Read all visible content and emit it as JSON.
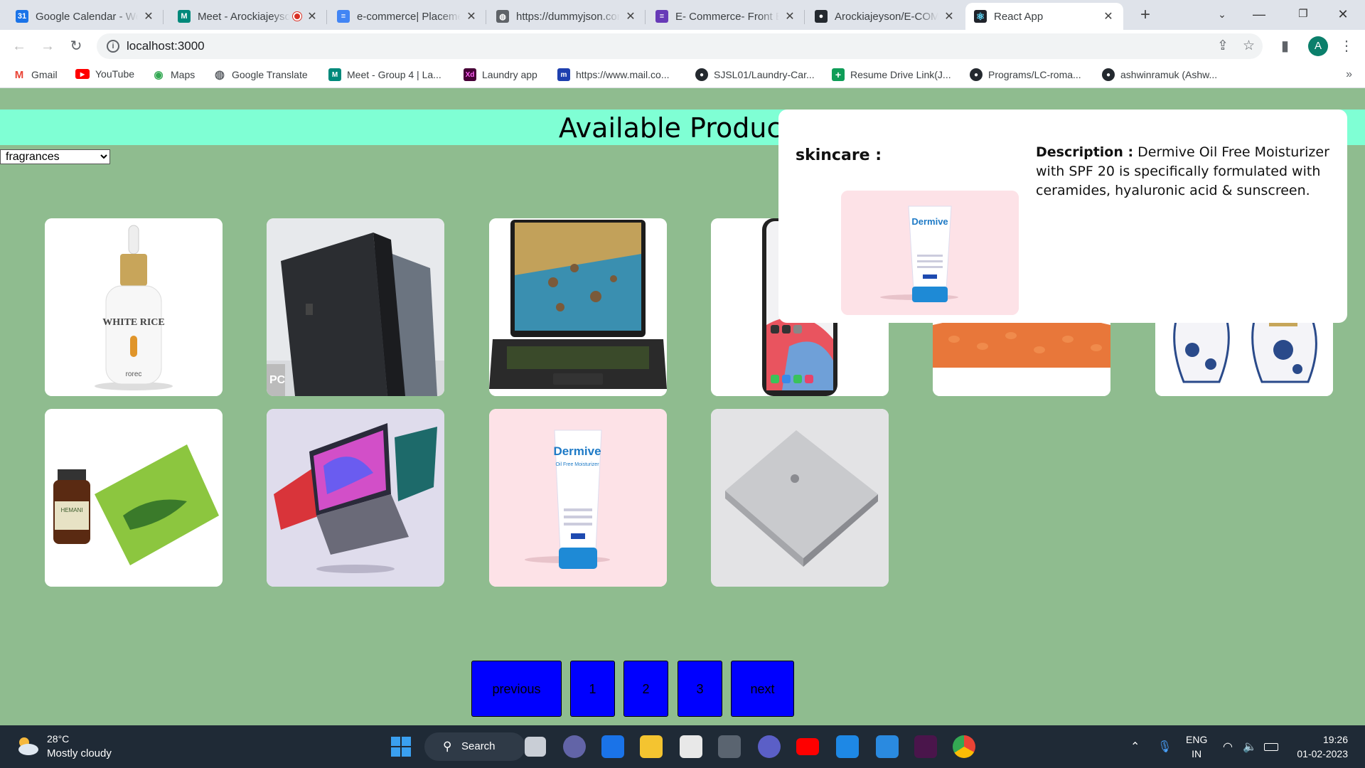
{
  "browser": {
    "tabs": [
      {
        "title": "Google Calendar - Week",
        "favicon": "calendar-icon",
        "color": "#1a73e8",
        "glyph": "31"
      },
      {
        "title": "Meet - Arockiajeyson",
        "favicon": "meet-icon",
        "color": "#00897b",
        "glyph": "M"
      },
      {
        "title": "e-commerce| Placement",
        "favicon": "docs-icon",
        "color": "#4285f4",
        "glyph": "≡"
      },
      {
        "title": "https://dummyjson.com",
        "favicon": "globe-icon",
        "color": "#5f6368",
        "glyph": "◍"
      },
      {
        "title": "E- Commerce- Front End",
        "favicon": "forms-icon",
        "color": "#673ab7",
        "glyph": "≡"
      },
      {
        "title": "Arockiajeyson/E-COMMERCE",
        "favicon": "github-icon",
        "color": "#24292f",
        "glyph": "●"
      },
      {
        "title": "React App",
        "favicon": "react-icon",
        "color": "#20232a",
        "glyph": "⚛"
      }
    ],
    "address": "localhost:3000",
    "profile_initial": "A",
    "bookmarks": [
      {
        "label": "Gmail",
        "icon": "gmail-icon",
        "color": "#ea4335",
        "glyph": "M"
      },
      {
        "label": "YouTube",
        "icon": "youtube-icon",
        "color": "#ff0000",
        "glyph": "▶"
      },
      {
        "label": "Maps",
        "icon": "maps-icon",
        "color": "#34a853",
        "glyph": "◉"
      },
      {
        "label": "Google Translate",
        "icon": "globe-icon",
        "color": "#5f6368",
        "glyph": "◍"
      },
      {
        "label": "Meet - Group 4 | La...",
        "icon": "meet-icon",
        "color": "#00897b",
        "glyph": "M"
      },
      {
        "label": "Laundry app",
        "icon": "xd-icon",
        "color": "#470137",
        "glyph": "Xd"
      },
      {
        "label": "https://www.mail.co...",
        "icon": "mail-icon",
        "color": "#1e40af",
        "glyph": "m"
      },
      {
        "label": "SJSL01/Laundry-Car...",
        "icon": "github-icon",
        "color": "#24292f",
        "glyph": "●"
      },
      {
        "label": "Resume Drive Link(J...",
        "icon": "sheets-icon",
        "color": "#0f9d58",
        "glyph": "+"
      },
      {
        "label": "Programs/LC-roma...",
        "icon": "github-icon",
        "color": "#24292f",
        "glyph": "●"
      },
      {
        "label": "ashwinramuk (Ashw...",
        "icon": "github-icon",
        "color": "#24292f",
        "glyph": "●"
      }
    ]
  },
  "page": {
    "title": "Available Products",
    "category_options": [
      "fragrances"
    ],
    "selected_category": "fragrances",
    "pagination": {
      "previous": "previous",
      "pages": [
        "1",
        "2",
        "3"
      ],
      "next": "next"
    }
  },
  "modal": {
    "category_label": "skincare :",
    "description_label": "Description :",
    "description": "Dermive Oil Free Moisturizer with SPF 20 is specifically formulated with ceramides, hyaluronic acid & sunscreen."
  },
  "taskbar": {
    "temperature": "28°C",
    "weather": "Mostly cloudy",
    "search": "Search",
    "lang_line1": "ENG",
    "lang_line2": "IN",
    "time": "19:26",
    "date": "01-02-2023"
  }
}
